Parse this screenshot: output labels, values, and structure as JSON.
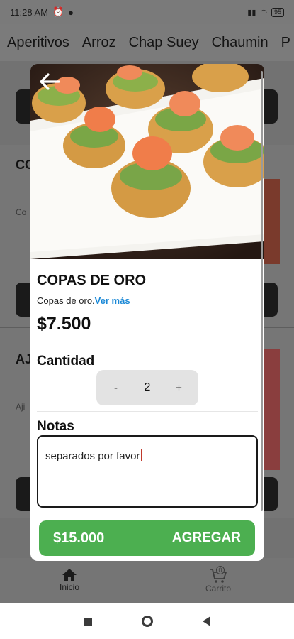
{
  "status_bar": {
    "time": "11:28 AM",
    "battery": "95"
  },
  "tabs": [
    "Aperitivos",
    "Arroz",
    "Chap Suey",
    "Chaumin",
    "P"
  ],
  "background": {
    "card1_title": "CO",
    "card1_desc": "Co",
    "card2_title": "AJ",
    "card2_desc": "Aji"
  },
  "modal": {
    "back_icon": "arrow-left-icon",
    "product": {
      "name": "COPAS DE ORO",
      "description": "Copas de oro.",
      "ver_mas": "Ver más",
      "price": "$7.500"
    },
    "quantity": {
      "label": "Cantidad",
      "minus": "-",
      "value": "2",
      "plus": "+"
    },
    "notes": {
      "label": "Notas",
      "value": "separados por favor"
    },
    "add_button": {
      "total": "$15.000",
      "label": "AGREGAR"
    }
  },
  "bottom_nav": {
    "home_label": "Inicio",
    "cart_label": "Carrito",
    "cart_count": "0"
  },
  "colors": {
    "accent_green": "#4caf50",
    "link_blue": "#1a88d6"
  }
}
